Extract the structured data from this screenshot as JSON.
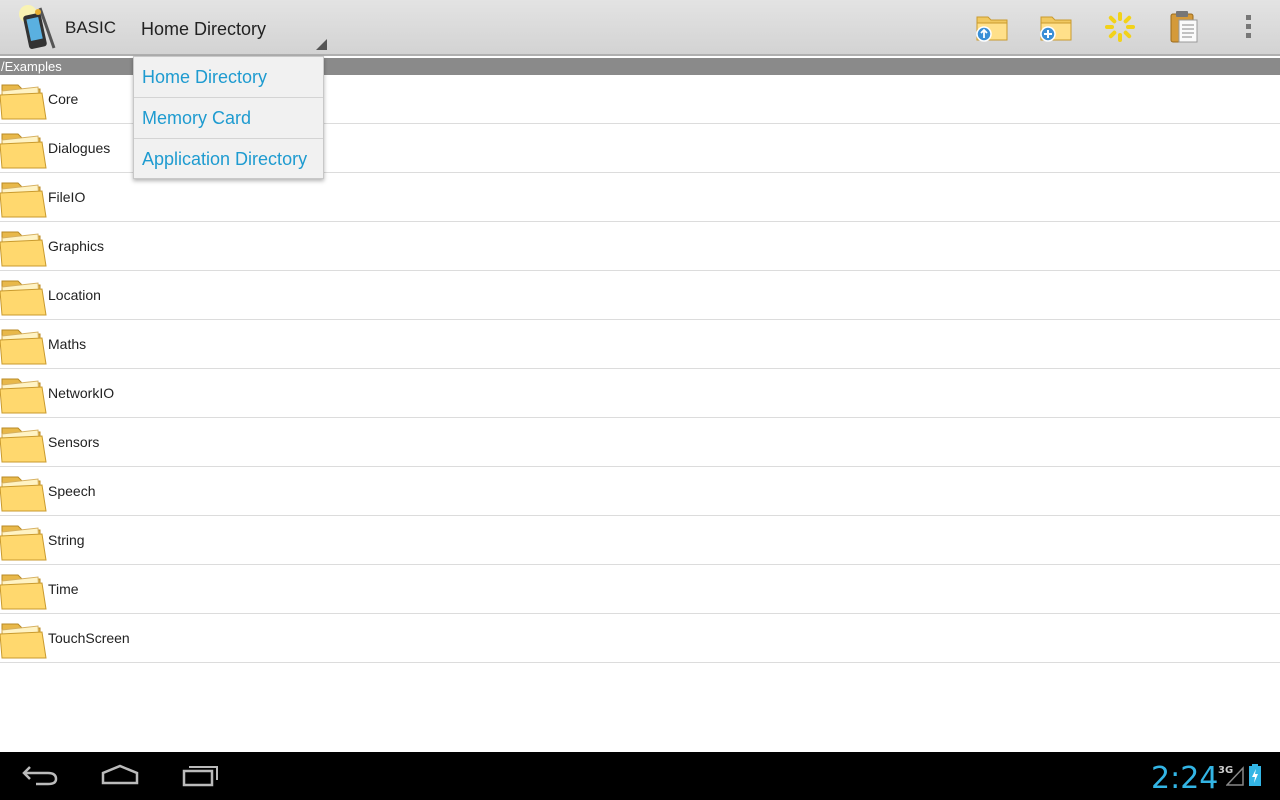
{
  "app": {
    "title": "BASIC",
    "icon": "app-logo-icon"
  },
  "nav": {
    "selected": "Home Directory",
    "options": [
      "Home Directory",
      "Memory Card",
      "Application Directory"
    ]
  },
  "actions": [
    {
      "name": "go-up-folder-icon"
    },
    {
      "name": "new-folder-icon"
    },
    {
      "name": "refresh-icon"
    },
    {
      "name": "paste-clipboard-icon"
    },
    {
      "name": "overflow-menu-icon"
    }
  ],
  "path": "/Examples",
  "folders": [
    "Core",
    "Dialogues",
    "FileIO",
    "Graphics",
    "Location",
    "Maths",
    "NetworkIO",
    "Sensors",
    "Speech",
    "String",
    "Time",
    "TouchScreen"
  ],
  "status": {
    "time": "2:24",
    "network": "3G"
  },
  "colors": {
    "accent": "#33b5e5",
    "dropdown_text": "#1e9bd0"
  }
}
